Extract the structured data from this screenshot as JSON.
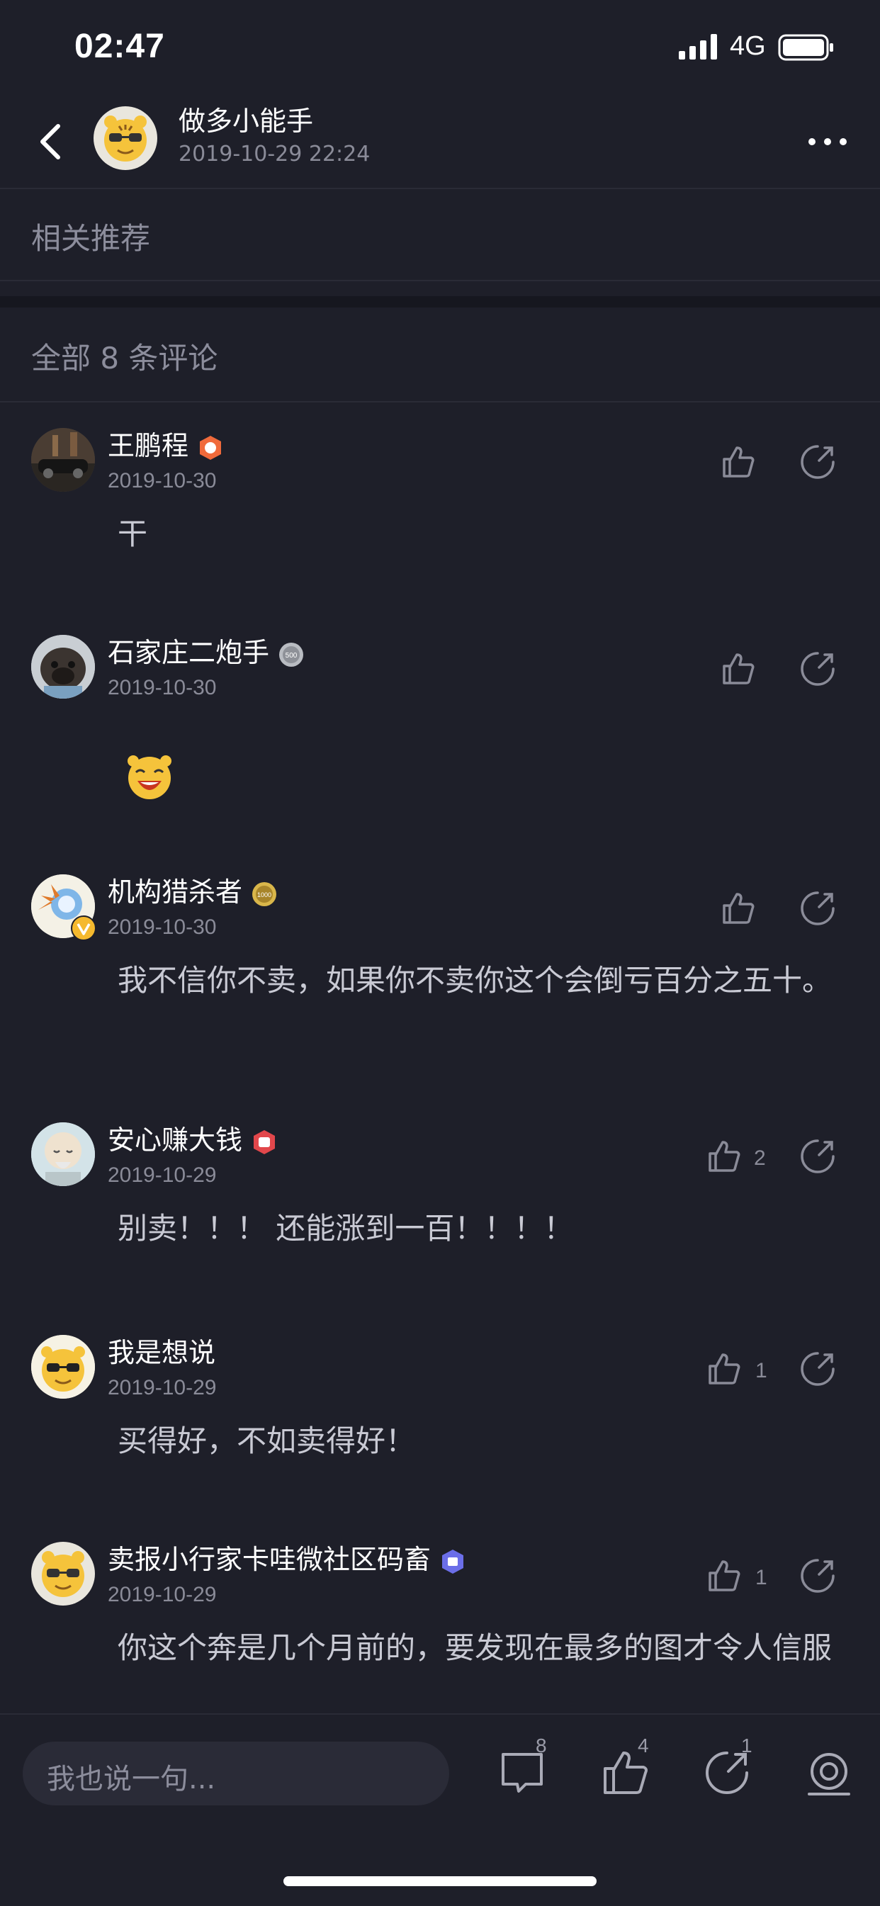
{
  "status_bar": {
    "time": "02:47",
    "network": "4G"
  },
  "post": {
    "author": "做多小能手",
    "datetime": "2019-10-29 22:24"
  },
  "recommend": {
    "title": "相关推荐"
  },
  "comments_header": {
    "title": "全部 8 条评论"
  },
  "comments": [
    {
      "name": "王鹏程",
      "date": "2019-10-30",
      "text": "干",
      "likes": "",
      "badge_icon": "orange-level-badge-icon",
      "avatar_icon": "car-photo-avatar"
    },
    {
      "name": "石家庄二炮手",
      "date": "2019-10-30",
      "text": "",
      "likes": "",
      "badge_icon": "silver-500-badge-icon",
      "avatar_icon": "pug-dog-avatar",
      "sticker": "laughing-tiger-sticker"
    },
    {
      "name": "机构猎杀者",
      "date": "2019-10-30",
      "text": "我不信你不卖，如果你不卖你这个会倒亏百分之五十。",
      "likes": "",
      "badge_icon": "gold-1000-badge-icon",
      "avatar_icon": "burst-avatar-verified"
    },
    {
      "name": "安心赚大钱",
      "date": "2019-10-29",
      "text": "别卖！！！ 还能涨到一百！！！！",
      "likes": "2",
      "badge_icon": "red-level-badge-icon",
      "avatar_icon": "buddha-avatar"
    },
    {
      "name": "我是想说",
      "date": "2019-10-29",
      "text": "买得好，不如卖得好！",
      "likes": "1",
      "badge_icon": "",
      "avatar_icon": "tiger-sunglasses-avatar"
    },
    {
      "name": "卖报小行家卡哇微社区码畜",
      "date": "2019-10-29",
      "text": "你这个奔是几个月前的，要发现在最多的图才令人信服",
      "likes": "1",
      "badge_icon": "purple-level-badge-icon",
      "avatar_icon": "tiger-avatar"
    }
  ],
  "bottom_bar": {
    "placeholder": "我也说一句...",
    "comment_count": "8",
    "like_count": "4",
    "share_count": "1"
  },
  "colors": {
    "background": "#1e1f29",
    "muted_text": "#8a8b98",
    "accent_yellow": "#f5c33b"
  }
}
